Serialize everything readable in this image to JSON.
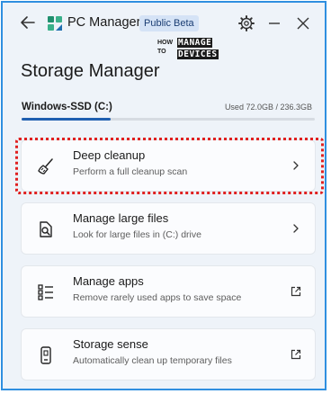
{
  "titlebar": {
    "app_title": "PC Manager",
    "badge": "Public Beta"
  },
  "watermark": {
    "line1": "HOW",
    "line2": "TO",
    "word1": "MANAGE",
    "word2": "DEVICES"
  },
  "page": {
    "title": "Storage Manager"
  },
  "drive": {
    "name": "Windows-SSD (C:)",
    "usage_text": "Used 72.0GB / 236.3GB",
    "used_fraction": 0.305
  },
  "cards": [
    {
      "title": "Deep cleanup",
      "desc": "Perform a full cleanup scan",
      "icon": "broom-icon",
      "trail": "chevron-right-icon"
    },
    {
      "title": "Manage large files",
      "desc": "Look for large files in (C:) drive",
      "icon": "file-search-icon",
      "trail": "chevron-right-icon"
    },
    {
      "title": "Manage apps",
      "desc": "Remove rarely used apps to save space",
      "icon": "app-list-icon",
      "trail": "external-link-icon"
    },
    {
      "title": "Storage sense",
      "desc": "Automatically clean up temporary files",
      "icon": "phone-storage-icon",
      "trail": "external-link-icon"
    }
  ],
  "colors": {
    "accent": "#1f5fb0",
    "window_border": "#2f8fe0",
    "highlight": "#e02020"
  }
}
